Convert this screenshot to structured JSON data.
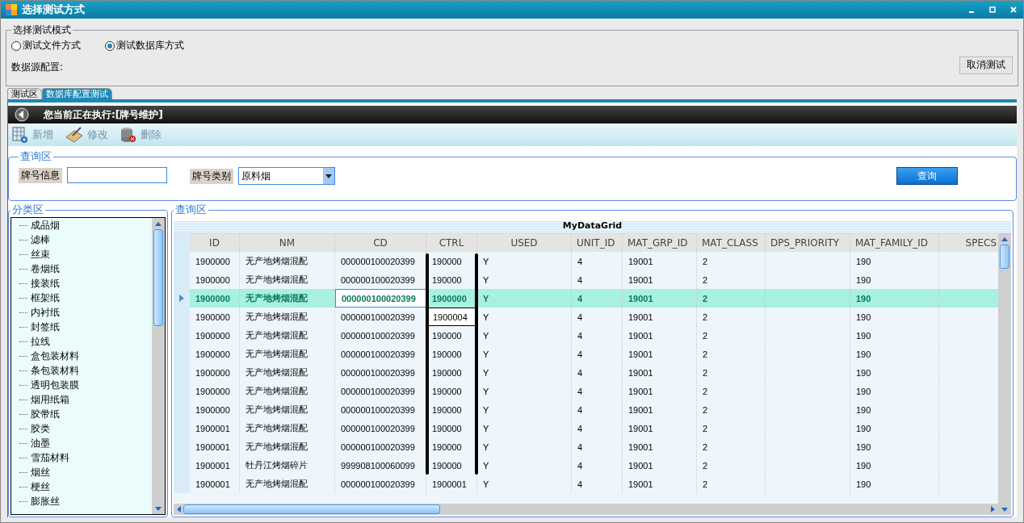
{
  "window": {
    "title": "选择测试方式"
  },
  "mode_group": {
    "legend": "选择测试模式",
    "options": [
      {
        "label": "测试文件方式",
        "selected": false
      },
      {
        "label": "测试数据库方式",
        "selected": true
      }
    ],
    "datasource_label": "数据源配置:",
    "cancel_button": "取消测试"
  },
  "tabs": [
    {
      "label": "测试区",
      "selected": false
    },
    {
      "label": "数据库配置测试",
      "selected": true
    }
  ],
  "header": {
    "title": "您当前正在执行:[牌号维护]"
  },
  "toolbar": [
    {
      "kind": "add",
      "label": "新增"
    },
    {
      "kind": "edit",
      "label": "修改"
    },
    {
      "kind": "delete",
      "label": "删除"
    }
  ],
  "query": {
    "legend": "查询区",
    "fields": [
      {
        "kind": "text",
        "label": "牌号信息"
      },
      {
        "kind": "select",
        "label": "牌号类别",
        "value": "原料烟"
      }
    ],
    "search_button": "查询"
  },
  "category": {
    "legend": "分类区",
    "items": [
      "成品烟",
      "滤棒",
      "丝束",
      "卷烟纸",
      "接装纸",
      "框架纸",
      "内衬纸",
      "封签纸",
      "拉线",
      "盒包装材料",
      "条包装材料",
      "透明包装膜",
      "烟用纸箱",
      "胶带纸",
      "胶类",
      "油墨",
      "雪茄材料",
      "烟丝",
      "梗丝",
      "膨胀丝"
    ]
  },
  "grid": {
    "legend": "查询区",
    "title": "MyDataGrid",
    "columns": [
      "ID",
      "NM",
      "CD",
      "CTRL",
      "USED",
      "UNIT_ID",
      "MAT_GRP_ID",
      "MAT_CLASS",
      "DPS_PRIORITY",
      "MAT_FAMILY_ID",
      "SPECS"
    ],
    "rows": [
      {
        "selected": false,
        "cells": [
          "1900000",
          "无产地烤烟混配",
          "000000100020399",
          "190000",
          "Y",
          "4",
          "19001",
          "2",
          "",
          "190",
          ""
        ]
      },
      {
        "selected": false,
        "cells": [
          "1900000",
          "无产地烤烟混配",
          "000000100020399",
          "190000",
          "Y",
          "4",
          "19001",
          "2",
          "",
          "190",
          ""
        ]
      },
      {
        "selected": true,
        "cells": [
          "1900000",
          "无产地烤烟混配",
          {
            "text": "000000100020399",
            "kind": "current"
          },
          "1900000",
          "Y",
          "4",
          "19001",
          "2",
          "",
          "190",
          ""
        ]
      },
      {
        "selected": false,
        "cells": [
          "1900000",
          "无产地烤烟混配",
          "000000100020399",
          {
            "text": "1900004",
            "kind": "editor"
          },
          "Y",
          "4",
          "19001",
          "2",
          "",
          "190",
          ""
        ]
      },
      {
        "selected": false,
        "cells": [
          "1900000",
          "无产地烤烟混配",
          "000000100020399",
          "190000",
          "Y",
          "4",
          "19001",
          "2",
          "",
          "190",
          ""
        ]
      },
      {
        "selected": false,
        "cells": [
          "1900000",
          "无产地烤烟混配",
          "000000100020399",
          "190000",
          "Y",
          "4",
          "19001",
          "2",
          "",
          "190",
          ""
        ]
      },
      {
        "selected": false,
        "cells": [
          "1900000",
          "无产地烤烟混配",
          "000000100020399",
          "190000",
          "Y",
          "4",
          "19001",
          "2",
          "",
          "190",
          ""
        ]
      },
      {
        "selected": false,
        "cells": [
          "1900000",
          "无产地烤烟混配",
          "000000100020399",
          "190000",
          "Y",
          "4",
          "19001",
          "2",
          "",
          "190",
          ""
        ]
      },
      {
        "selected": false,
        "cells": [
          "1900000",
          "无产地烤烟混配",
          "000000100020399",
          "190000",
          "Y",
          "4",
          "19001",
          "2",
          "",
          "190",
          ""
        ]
      },
      {
        "selected": false,
        "cells": [
          "1900001",
          "无产地烤烟混配",
          "000000100020399",
          "190000",
          "Y",
          "4",
          "19001",
          "2",
          "",
          "190",
          ""
        ]
      },
      {
        "selected": false,
        "cells": [
          "1900001",
          "无产地烤烟混配",
          "000000100020399",
          "190000",
          "Y",
          "4",
          "19001",
          "2",
          "",
          "190",
          ""
        ]
      },
      {
        "selected": false,
        "cells": [
          "1900001",
          "牡丹江烤烟碎片",
          "999908100060099",
          "190000",
          "Y",
          "4",
          "19001",
          "2",
          "",
          "190",
          ""
        ]
      },
      {
        "selected": false,
        "cells": [
          "1900001",
          "无产地烤烟混配",
          "000000100020399",
          "1900001",
          "Y",
          "4",
          "19001",
          "2",
          "",
          "190",
          ""
        ]
      }
    ]
  }
}
